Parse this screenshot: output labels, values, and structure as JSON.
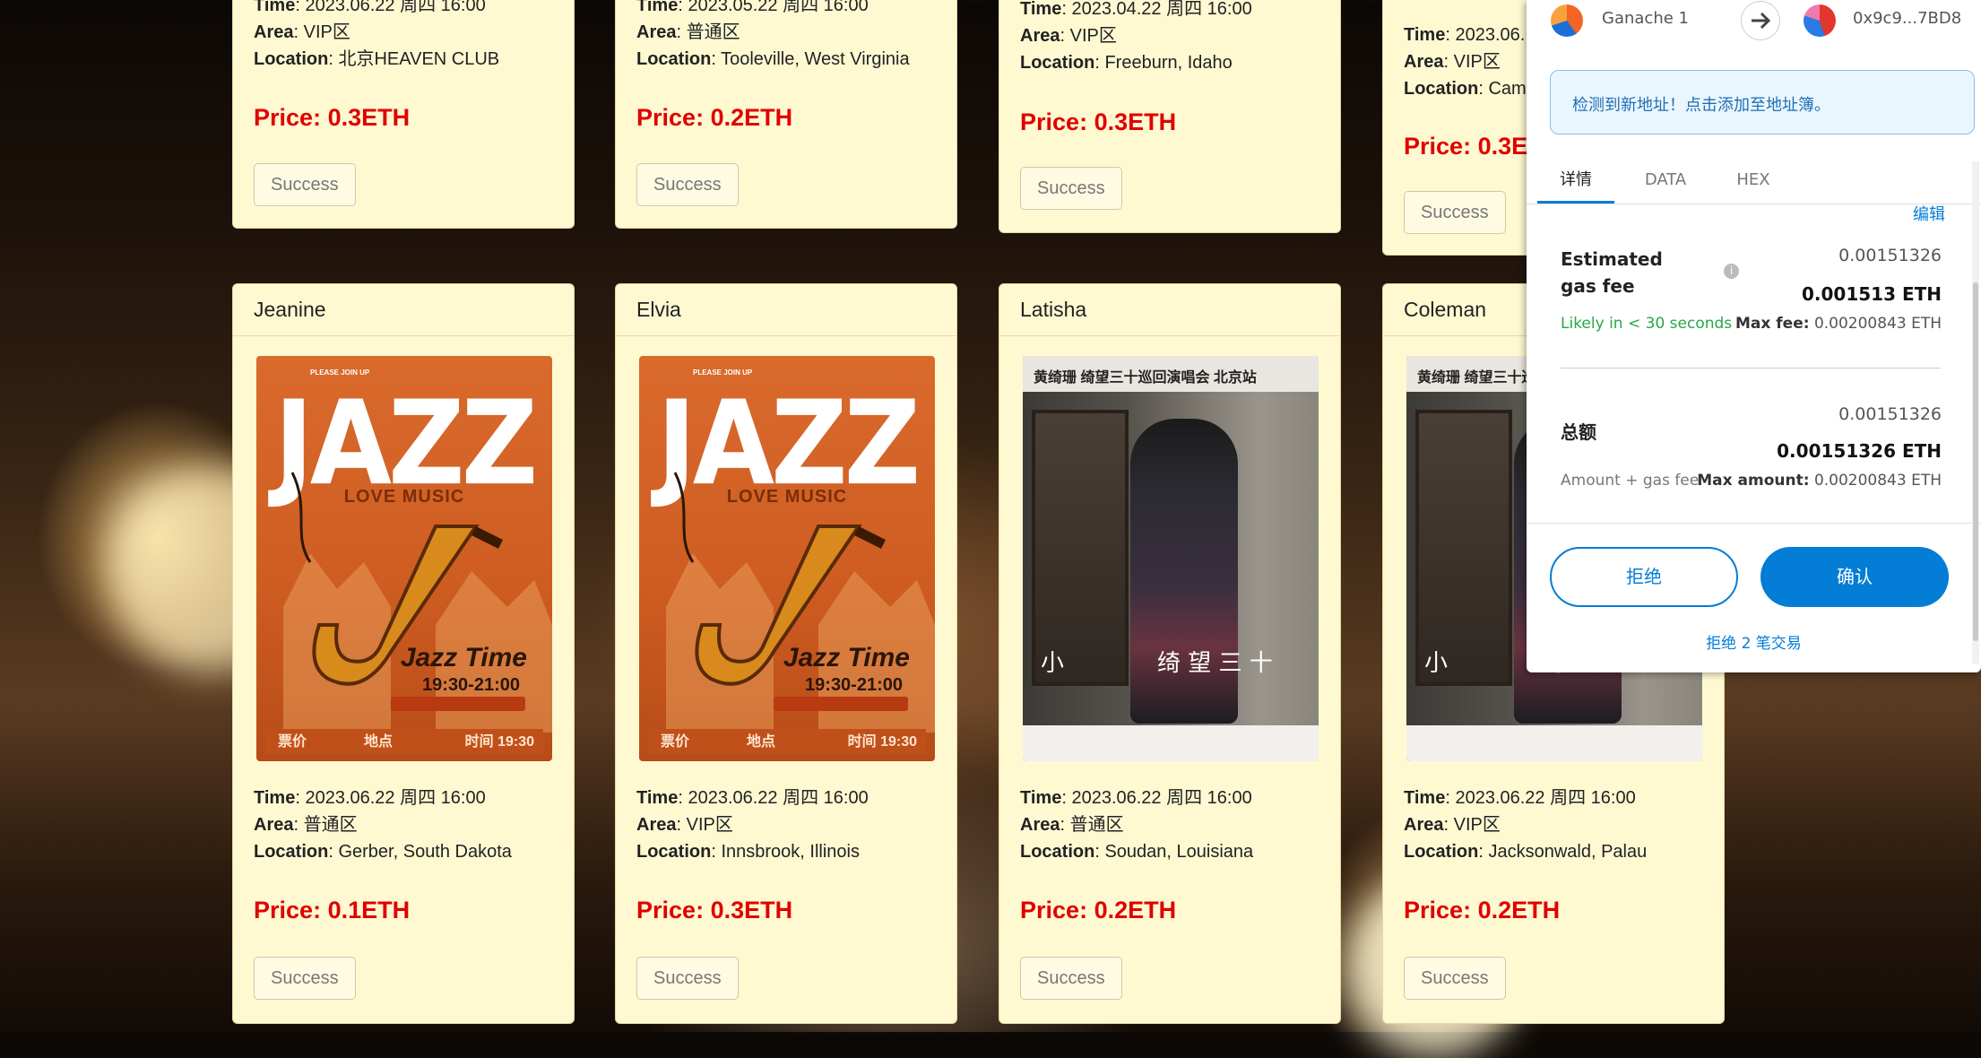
{
  "cards_top": [
    {
      "time": "2023.06.22 周四 16:00",
      "area": "VIP区",
      "location": "北京HEAVEN CLUB",
      "price": "0.3ETH",
      "status": "Success"
    },
    {
      "time": "2023.05.22 周四 16:00",
      "area": "普通区",
      "location": "Tooleville, West Virginia",
      "price": "0.2ETH",
      "status": "Success"
    },
    {
      "time": "2023.04.22 周四 16:00",
      "area": "VIP区",
      "location": "Freeburn, Idaho",
      "price": "0.3ETH",
      "status": "Success"
    },
    {
      "time": "2023.06.",
      "area": "VIP区",
      "location": "Cam",
      "price": "0.3ET",
      "status": "Success"
    }
  ],
  "cards_bottom": [
    {
      "name": "Jeanine",
      "poster": "jazz",
      "time": "2023.06.22 周四 16:00",
      "area": "普通区",
      "location": "Gerber, South Dakota",
      "price": "0.1ETH",
      "status": "Success"
    },
    {
      "name": "Elvia",
      "poster": "jazz",
      "time": "2023.06.22 周四 16:00",
      "area": "VIP区",
      "location": "Innsbrook, Illinois",
      "price": "0.3ETH",
      "status": "Success"
    },
    {
      "name": "Latisha",
      "poster": "singer",
      "time": "2023.06.22 周四 16:00",
      "area": "普通区",
      "location": "Soudan, Louisiana",
      "price": "0.2ETH",
      "status": "Success"
    },
    {
      "name": "Coleman",
      "poster": "singer",
      "time": "2023.06.22 周四 16:00",
      "area": "VIP区",
      "location": "Jacksonwald, Palau",
      "price": "0.2ETH",
      "status": "Success"
    }
  ],
  "labels": {
    "time": "Time",
    "area": "Area",
    "location": "Location",
    "price": "Price"
  },
  "jazz_poster": {
    "please": "PLEASE JOIN UP",
    "title": "JAZZ",
    "love": "LOVE MUSIC",
    "sub": "Jazz Time",
    "hours": "19:30-21:00",
    "foot_left": "票价",
    "foot_mid": "地点",
    "foot_right": "时间 19:30"
  },
  "singer_poster": {
    "header": "黄绮珊  绮望三十巡回演唱会  北京站",
    "chars_left": "小",
    "chars_right": "绮 望 三 十"
  },
  "metamask": {
    "account": "Ganache 1",
    "address": "0x9c9...7BD8",
    "notice": "检测到新地址！点击添加至地址簿。",
    "tabs": [
      "详情",
      "DATA",
      "HEX"
    ],
    "edit": "编辑",
    "gas_label": "Estimated gas fee",
    "gas_small": "0.00151326",
    "gas_main": "0.001513 ETH",
    "likely": "Likely in < 30 seconds",
    "max_fee_label": "Max fee:",
    "max_fee": "0.00200843 ETH",
    "total_label": "总额",
    "total_small": "0.00151326",
    "total_main": "0.00151326 ETH",
    "amount_gas": "Amount + gas fee",
    "max_amount_label": "Max amount:",
    "max_amount": "0.00200843 ETH",
    "reject": "拒绝",
    "confirm": "确认",
    "reject_all": "拒绝 2 笔交易",
    "accent": "#037dd6"
  }
}
